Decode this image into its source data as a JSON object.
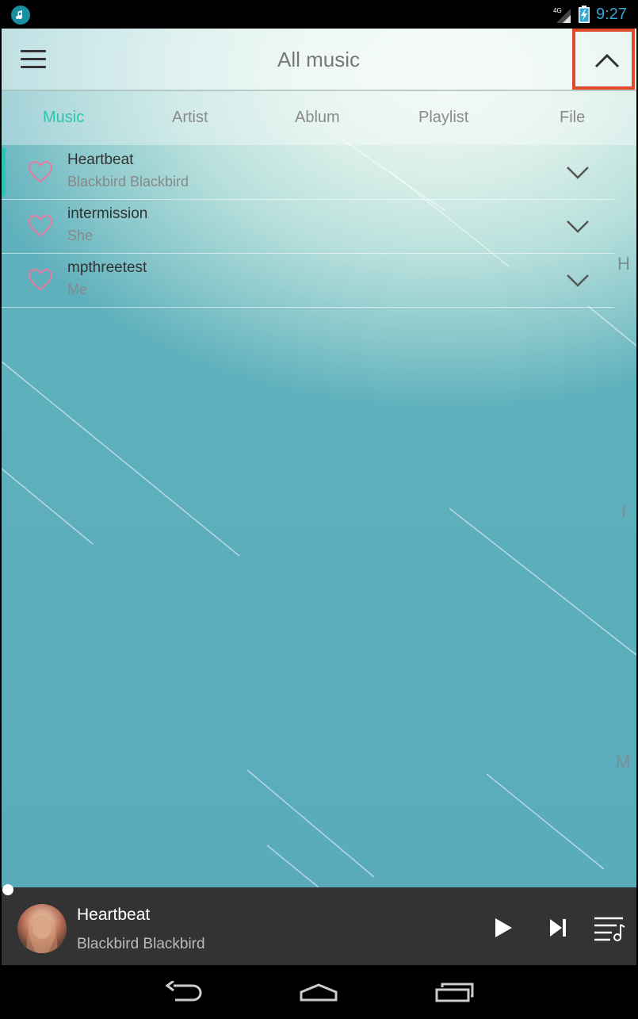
{
  "status_bar": {
    "time": "9:27",
    "network": "4G",
    "time_color": "#35a8d8"
  },
  "header": {
    "title": "All music",
    "menu_icon": "hamburger-menu-icon",
    "collapse_icon": "chevron-up-icon"
  },
  "tabs": [
    {
      "label": "Music",
      "active": true
    },
    {
      "label": "Artist",
      "active": false
    },
    {
      "label": "Ablum",
      "active": false
    },
    {
      "label": "Playlist",
      "active": false
    },
    {
      "label": "File",
      "active": false
    }
  ],
  "songs": [
    {
      "title": "Heartbeat",
      "artist": "Blackbird Blackbird",
      "playing": true
    },
    {
      "title": "intermission",
      "artist": "She",
      "playing": false
    },
    {
      "title": "mpthreetest",
      "artist": "Me",
      "playing": false
    }
  ],
  "index_letters": [
    "H",
    "I",
    "M"
  ],
  "player": {
    "title": "Heartbeat",
    "artist": "Blackbird Blackbird"
  },
  "colors": {
    "accent": "#2fc2b0",
    "highlight_box": "#e04a2c",
    "player_bg": "#333333"
  }
}
